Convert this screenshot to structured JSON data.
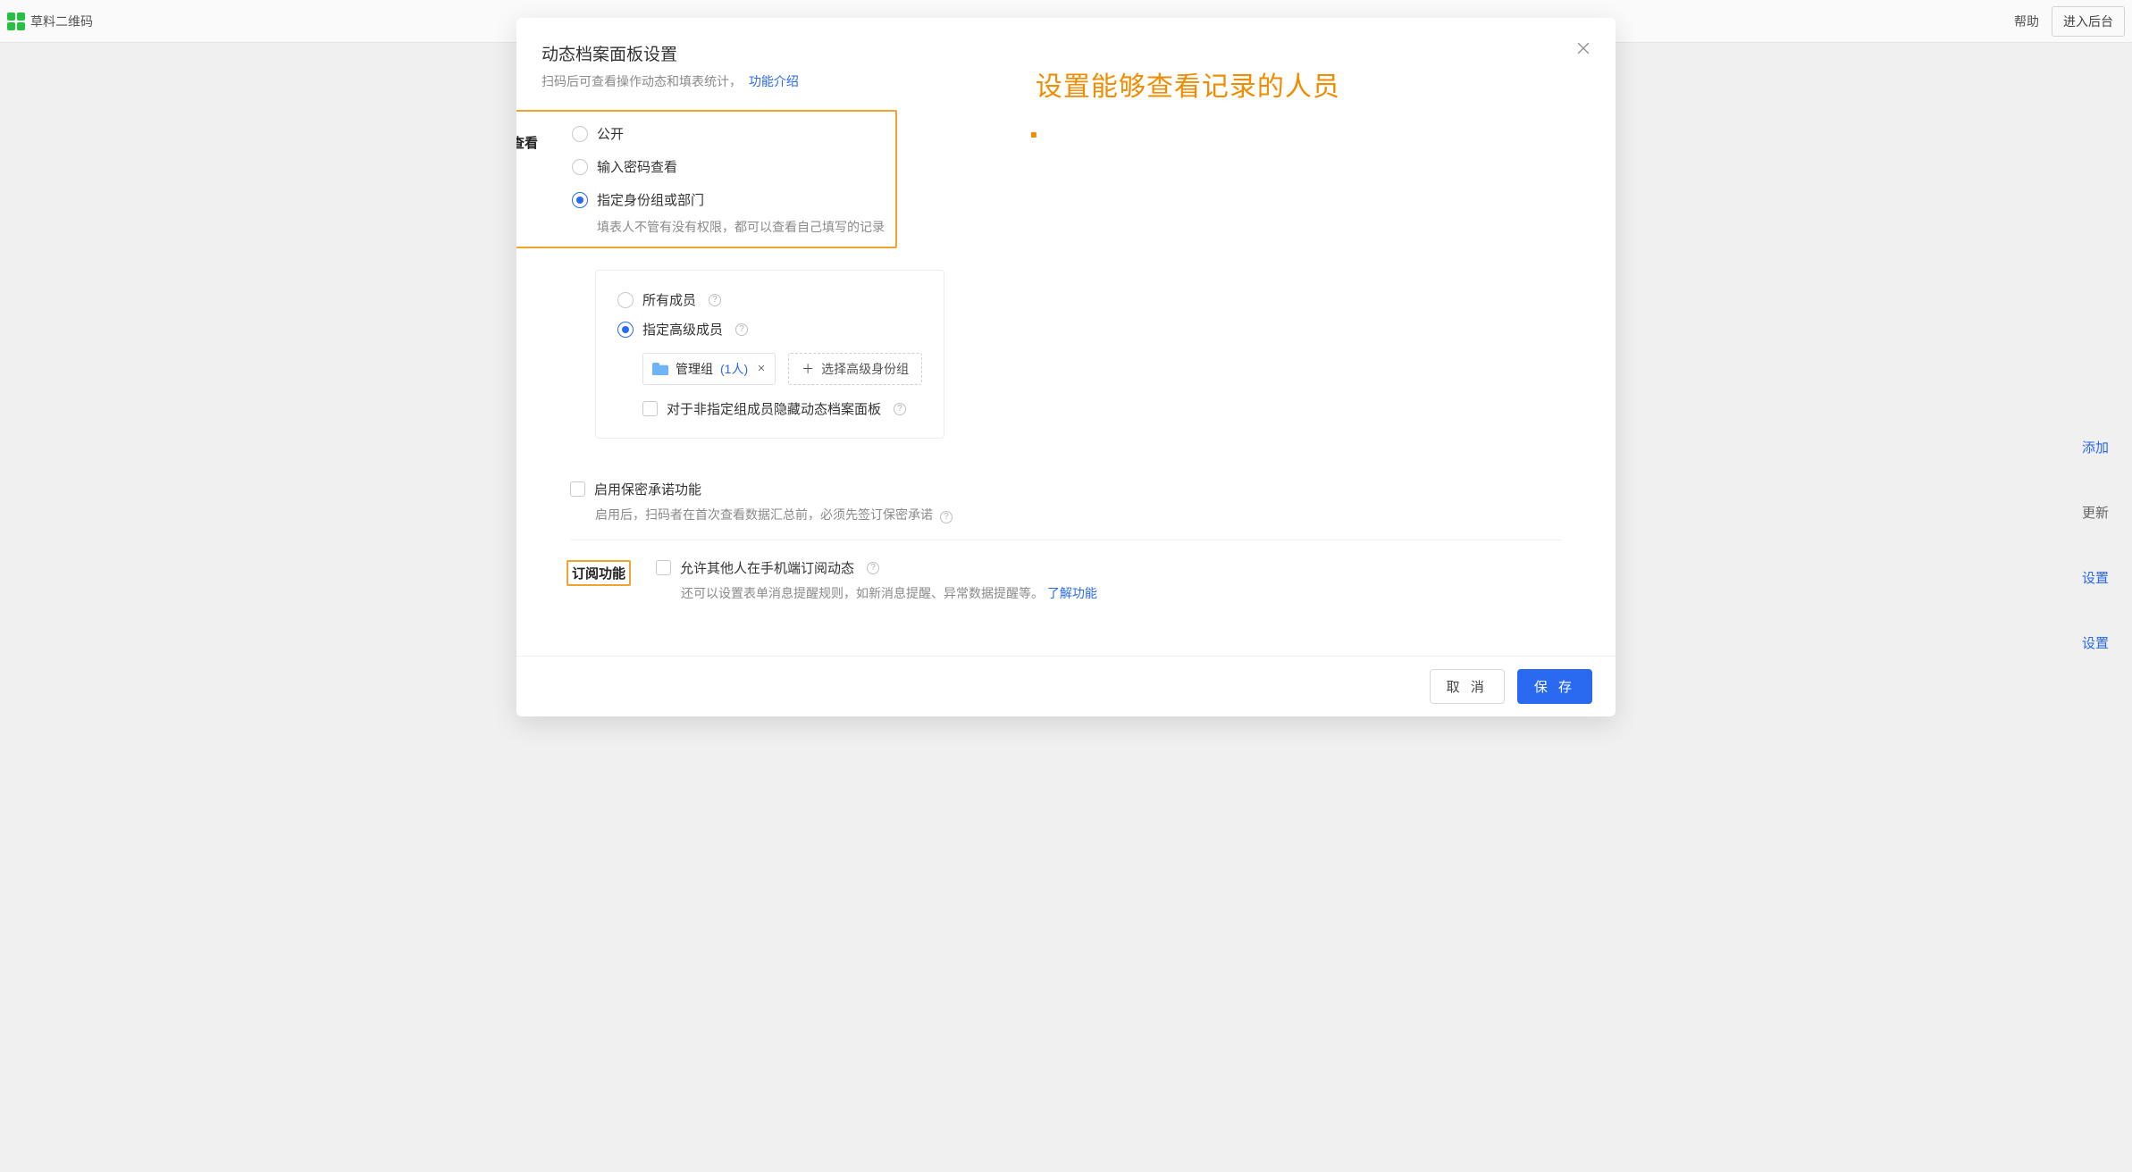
{
  "bg": {
    "brand": "草料二维码",
    "help": "帮助",
    "enter_backend": "进入后台",
    "side_links": [
      "添加",
      "更新",
      "设置",
      "设置"
    ]
  },
  "modal": {
    "title": "动态档案面板设置",
    "subtitle": "扫码后可查看操作动态和填表统计，",
    "subtitle_link": "功能介绍",
    "annotation": "设置能够查看记录的人员"
  },
  "who": {
    "label": "谁能查看",
    "opt_public": "公开",
    "opt_password": "输入密码查看",
    "opt_group": "指定身份组或部门",
    "opt_group_note": "填表人不管有没有权限，都可以查看自己填写的记录",
    "sub_all_members": "所有成员",
    "sub_assigned": "指定高级成员",
    "tag_name": "管理组",
    "tag_count": "(1人)",
    "add_group_btn": "选择高级身份组",
    "hide_checkbox": "对于非指定组成员隐藏动态档案面板"
  },
  "secrecy": {
    "checkbox_label": "启用保密承诺功能",
    "note": "启用后，扫码者在首次查看数据汇总前，必须先签订保密承诺"
  },
  "subscribe": {
    "label": "订阅功能",
    "checkbox_label": "允许其他人在手机端订阅动态",
    "note_prefix": "还可以设置表单消息提醒规则，如新消息提醒、异常数据提醒等。",
    "note_link": "了解功能"
  },
  "footer": {
    "cancel": "取 消",
    "save": "保 存"
  }
}
